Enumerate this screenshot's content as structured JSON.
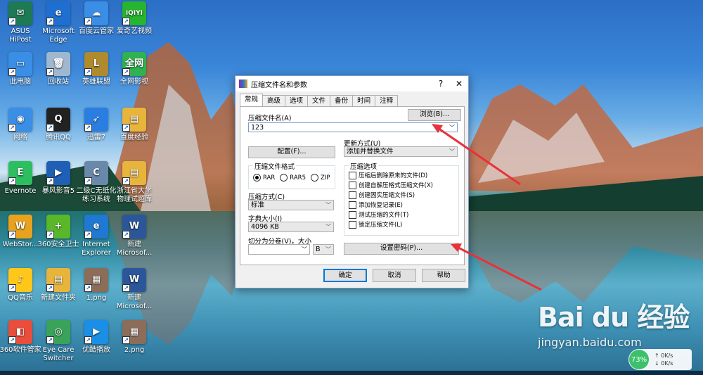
{
  "desktop": {
    "icons": [
      {
        "label": "ASUS\nHiPost",
        "color": "#1d7a52",
        "glyph": "✉"
      },
      {
        "label": "Microsoft\nEdge",
        "color": "#1e6fd0",
        "glyph": "e"
      },
      {
        "label": "百度云管家",
        "color": "#3a8ee6",
        "glyph": "☁"
      },
      {
        "label": "爱奇艺视频",
        "color": "#27b42f",
        "glyph": "iQIYI"
      },
      {
        "label": "此电脑",
        "color": "#3a8ee6",
        "glyph": "▭"
      },
      {
        "label": "回收站",
        "color": "#9fb8d0",
        "glyph": "🗑"
      },
      {
        "label": "英雄联盟",
        "color": "#b08a2e",
        "glyph": "L"
      },
      {
        "label": "全网影视",
        "color": "#2fb24f",
        "glyph": "全网"
      },
      {
        "label": "网络",
        "color": "#3a8ee6",
        "glyph": "◉"
      },
      {
        "label": "腾讯QQ",
        "color": "#222",
        "glyph": "Q"
      },
      {
        "label": "迅雷7",
        "color": "#2a7de1",
        "glyph": "➶"
      },
      {
        "label": "百度经验",
        "color": "#e7b53c",
        "glyph": "▤"
      },
      {
        "label": "Evernote",
        "color": "#2dbe60",
        "glyph": "E"
      },
      {
        "label": "暴风影音5",
        "color": "#1f5fb5",
        "glyph": "▶"
      },
      {
        "label": "二级C无纸化\n练习系统",
        "color": "#6a88aa",
        "glyph": "C"
      },
      {
        "label": "浙江省大学\n物理试题库",
        "color": "#e7b53c",
        "glyph": "▤"
      },
      {
        "label": "WebStor...",
        "color": "#e9a21e",
        "glyph": "W"
      },
      {
        "label": "360安全卫士",
        "color": "#5ab72a",
        "glyph": "+"
      },
      {
        "label": "Internet\nExplorer",
        "color": "#1f78d1",
        "glyph": "e"
      },
      {
        "label": "新建\nMicrosof...",
        "color": "#2b579a",
        "glyph": "W"
      },
      {
        "label": "QQ音乐",
        "color": "#ffc71a",
        "glyph": "♪"
      },
      {
        "label": "新建文件夹",
        "color": "#e7b53c",
        "glyph": "▤"
      },
      {
        "label": "1.png",
        "color": "#8b6d5a",
        "glyph": "▦"
      },
      {
        "label": "新建\nMicrosof...",
        "color": "#2b579a",
        "glyph": "W"
      },
      {
        "label": "360软件管家",
        "color": "#e94e3c",
        "glyph": "◧"
      },
      {
        "label": "Eye Care\nSwitcher",
        "color": "#3aa35a",
        "glyph": "◎"
      },
      {
        "label": "优酷播放",
        "color": "#1b8ee6",
        "glyph": "▶"
      },
      {
        "label": "2.png",
        "color": "#8b6d5a",
        "glyph": "▦"
      }
    ]
  },
  "dialog": {
    "title": "压缩文件名和参数",
    "help": "?",
    "close": "✕",
    "tabs": [
      "常规",
      "高级",
      "选项",
      "文件",
      "备份",
      "时间",
      "注释"
    ],
    "archive_name_label": "压缩文件名(A)",
    "archive_name_value": "123",
    "browse_button": "浏览(B)...",
    "update_mode_label": "更新方式(U)",
    "update_mode_value": "添加并替换文件",
    "profile_button": "配置(F)...",
    "format_group_title": "压缩文件格式",
    "formats": [
      "RAR",
      "RAR5",
      "ZIP"
    ],
    "method_label": "压缩方式(C)",
    "method_value": "标准",
    "dict_label": "字典大小(I)",
    "dict_value": "4096 KB",
    "split_label": "切分为分卷(V)，大小",
    "split_value": "",
    "split_unit": "B",
    "options_group_title": "压缩选项",
    "options": [
      "压缩后删除原来的文件(D)",
      "创建自解压格式压缩文件(X)",
      "创建固实压缩文件(S)",
      "添加恢复记录(E)",
      "测试压缩的文件(T)",
      "锁定压缩文件(L)"
    ],
    "password_button": "设置密码(P)...",
    "ok_button": "确定",
    "cancel_button": "取消",
    "help_button": "帮助"
  },
  "annotation_color": "#e8323a",
  "watermark": {
    "logo": "Bai du 经验",
    "url": "jingyan.baidu.com"
  },
  "netwidget": {
    "percent": "73%",
    "up": "0K/s",
    "down": "0K/s"
  }
}
